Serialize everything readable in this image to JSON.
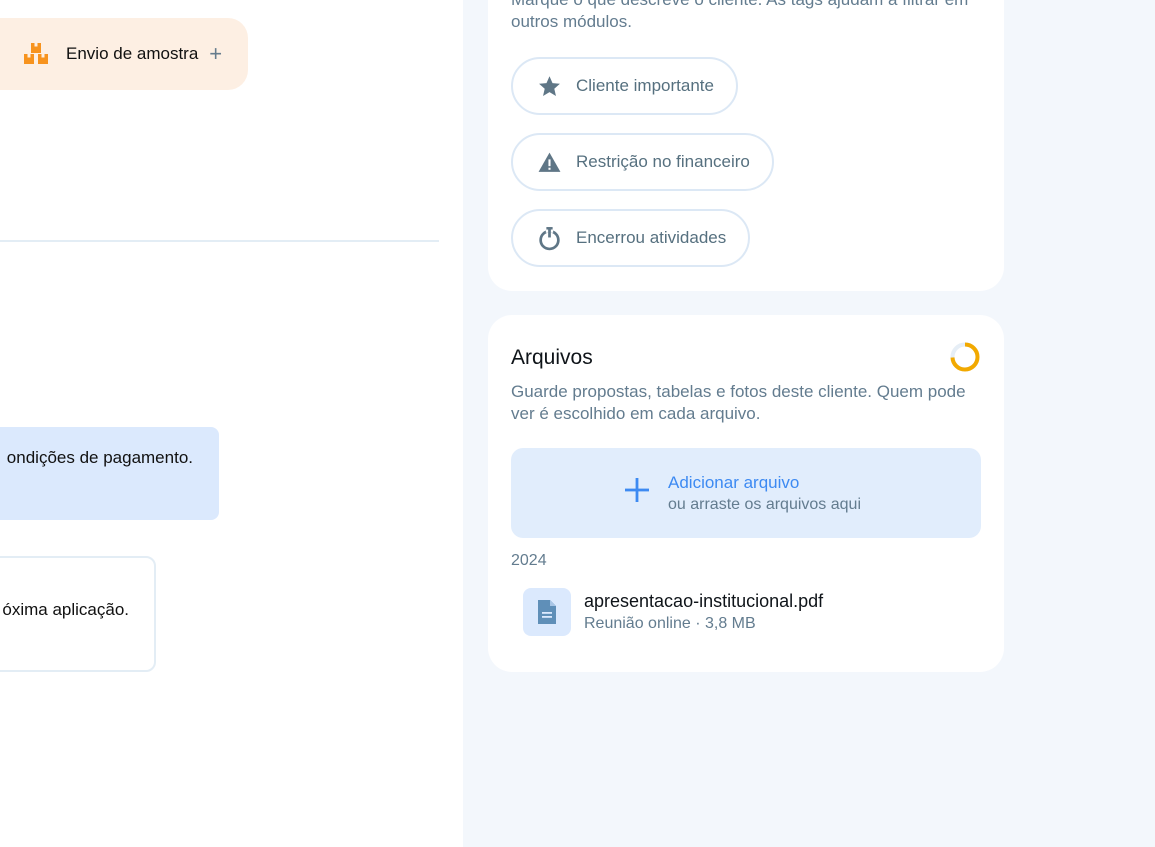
{
  "left": {
    "activity_chip": {
      "label": "Envio de amostra",
      "plus": "+",
      "icon": "boxes-icon",
      "color": "#f7931e"
    },
    "messages": [
      {
        "text": "ondições de pagamento."
      },
      {
        "text": "óxima aplicação."
      }
    ]
  },
  "tags": {
    "description": "Marque o que descreve o cliente. As tags ajudam a filtrar em outros módulos.",
    "items": [
      {
        "label": "Cliente importante",
        "icon": "star-icon"
      },
      {
        "label": "Restrição no financeiro",
        "icon": "warning-icon"
      },
      {
        "label": "Encerrou atividades",
        "icon": "power-icon"
      }
    ]
  },
  "files": {
    "title": "Arquivos",
    "description": "Guarde propostas, tabelas e fotos deste cliente. Quem pode ver é escolhido em cada arquivo.",
    "upload": {
      "title": "Adicionar arquivo",
      "subtitle": "ou arraste os arquivos aqui",
      "icon": "plus-icon"
    },
    "groups": [
      {
        "year": "2024",
        "items": [
          {
            "name": "apresentacao-institucional.pdf",
            "meta": "Reunião online · 3,8 MB",
            "icon": "document-icon"
          }
        ]
      }
    ]
  },
  "colors": {
    "accent_blue": "#3d8af2",
    "accent_orange": "#f7931e",
    "spinner": "#f2a900",
    "muted_text": "#637c8f"
  }
}
